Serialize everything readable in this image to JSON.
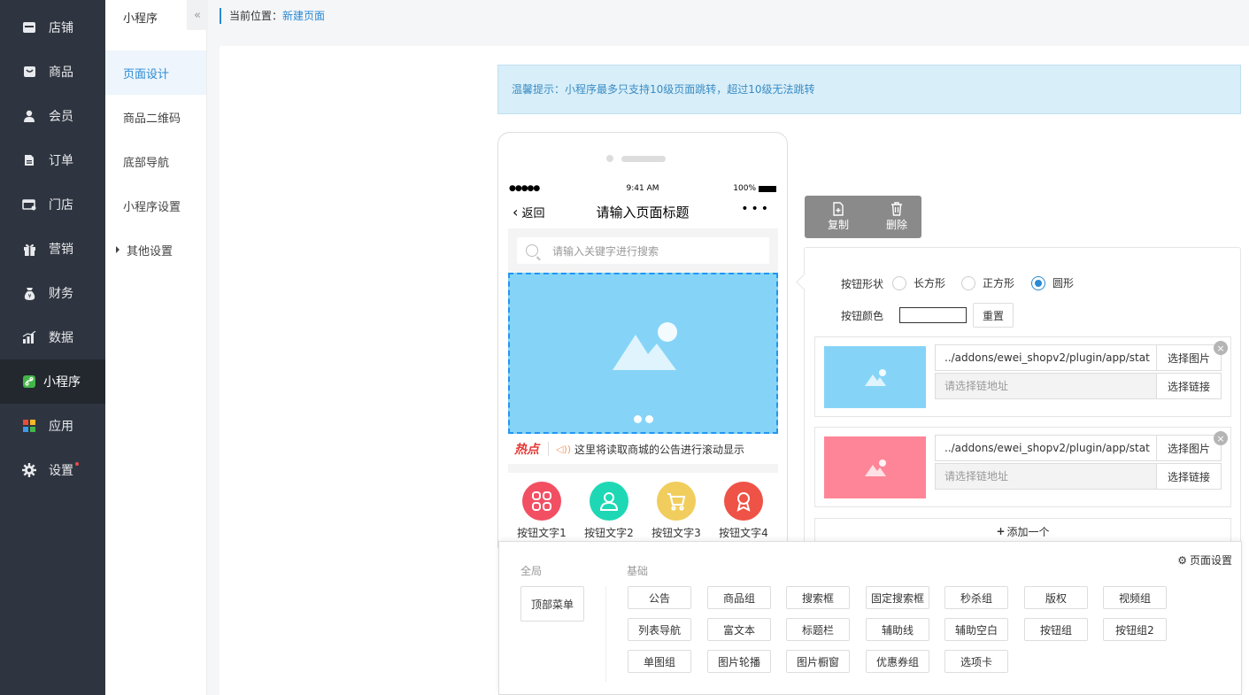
{
  "sidebar": {
    "items": [
      {
        "label": "店铺",
        "icon": "store-icon"
      },
      {
        "label": "商品",
        "icon": "goods-icon"
      },
      {
        "label": "会员",
        "icon": "user-icon"
      },
      {
        "label": "订单",
        "icon": "order-icon"
      },
      {
        "label": "门店",
        "icon": "shop-icon"
      },
      {
        "label": "营销",
        "icon": "gift-icon"
      },
      {
        "label": "财务",
        "icon": "money-bag-icon"
      },
      {
        "label": "数据",
        "icon": "chart-icon"
      },
      {
        "label": "小程序",
        "icon": "miniapp-icon"
      },
      {
        "label": "应用",
        "icon": "apps-icon"
      },
      {
        "label": "设置",
        "icon": "gear-icon"
      }
    ],
    "active": "小程序"
  },
  "subnav": {
    "title": "小程序",
    "collapse": "«",
    "items": [
      {
        "label": "页面设计"
      },
      {
        "label": "商品二维码"
      },
      {
        "label": "底部导航"
      },
      {
        "label": "小程序设置"
      },
      {
        "label": "其他设置"
      }
    ]
  },
  "breadcrumb": {
    "prefix": "当前位置：",
    "current": "新建页面"
  },
  "tip": "温馨提示：小程序最多只支持10级页面跳转，超过10级无法跳转",
  "phone": {
    "signal": "●●●●●",
    "time": "9:41 AM",
    "battery": "100%",
    "back": "返回",
    "title": "请输入页面标题",
    "more": "•••",
    "search_placeholder": "请输入关键字进行搜索",
    "notice_hot": "热点",
    "notice_text": "这里将读取商城的公告进行滚动显示",
    "buttons": [
      {
        "label": "按钮文字1",
        "color": "#f24f63"
      },
      {
        "label": "按钮文字2",
        "color": "#1ed8b5"
      },
      {
        "label": "按钮文字3",
        "color": "#f0cd5d"
      },
      {
        "label": "按钮文字4",
        "color": "#ef5246"
      }
    ]
  },
  "actions": {
    "copy": "复制",
    "delete": "删除"
  },
  "editor": {
    "shape_label": "按钮形状",
    "shapes": [
      "长方形",
      "正方形",
      "圆形"
    ],
    "shape_selected": "圆形",
    "color_label": "按钮颜色",
    "reset": "重置",
    "items": [
      {
        "url": "../addons/ewei_shopv2/plugin/app/stat",
        "link_placeholder": "请选择链地址",
        "choose_image": "选择图片",
        "choose_link": "选择链接",
        "thumb_color": "#85d4f7"
      },
      {
        "url": "../addons/ewei_shopv2/plugin/app/stat",
        "link_placeholder": "请选择链地址",
        "choose_image": "选择图片",
        "choose_link": "选择链接",
        "thumb_color": "#fe8597"
      }
    ],
    "add_one": "添加一个"
  },
  "palette": {
    "global_label": "全局",
    "basic_label": "基础",
    "page_settings": "页面设置",
    "global_items": [
      "顶部菜单"
    ],
    "basic_items": [
      "公告",
      "商品组",
      "搜索框",
      "固定搜索框",
      "秒杀组",
      "版权",
      "视频组",
      "列表导航",
      "富文本",
      "标题栏",
      "辅助线",
      "辅助空白",
      "按钮组",
      "按钮组2",
      "单图组",
      "图片轮播",
      "图片橱窗",
      "优惠券组",
      "选项卡"
    ]
  }
}
